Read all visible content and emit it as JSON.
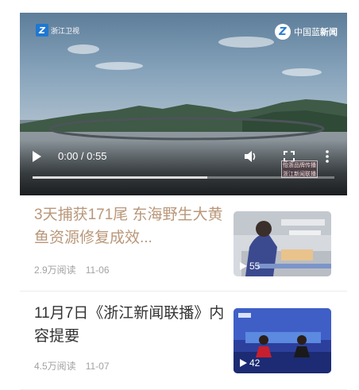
{
  "video": {
    "logo_left": "浙江卫视",
    "logo_right_prefix": "中国蓝",
    "logo_right_bold": "新闻",
    "time_display": "0:00 / 0:55",
    "watermark_line1": "怡浙品牌传播",
    "watermark_line2": "浙江新闻联播",
    "progress": 0.58,
    "icons": [
      "play-icon",
      "volume-icon",
      "fullscreen-icon",
      "more-vertical-icon"
    ]
  },
  "articles": [
    {
      "title": "3天捕获171尾 东海野生大黄鱼资源修复成效...",
      "views": "2.9万阅读",
      "date": "11-06",
      "duration": "55",
      "title_color": "#b9977a"
    },
    {
      "title": "11月7日《浙江新闻联播》内容提要",
      "views": "4.5万阅读",
      "date": "11-07",
      "duration": "42",
      "title_color": "#333333"
    }
  ]
}
